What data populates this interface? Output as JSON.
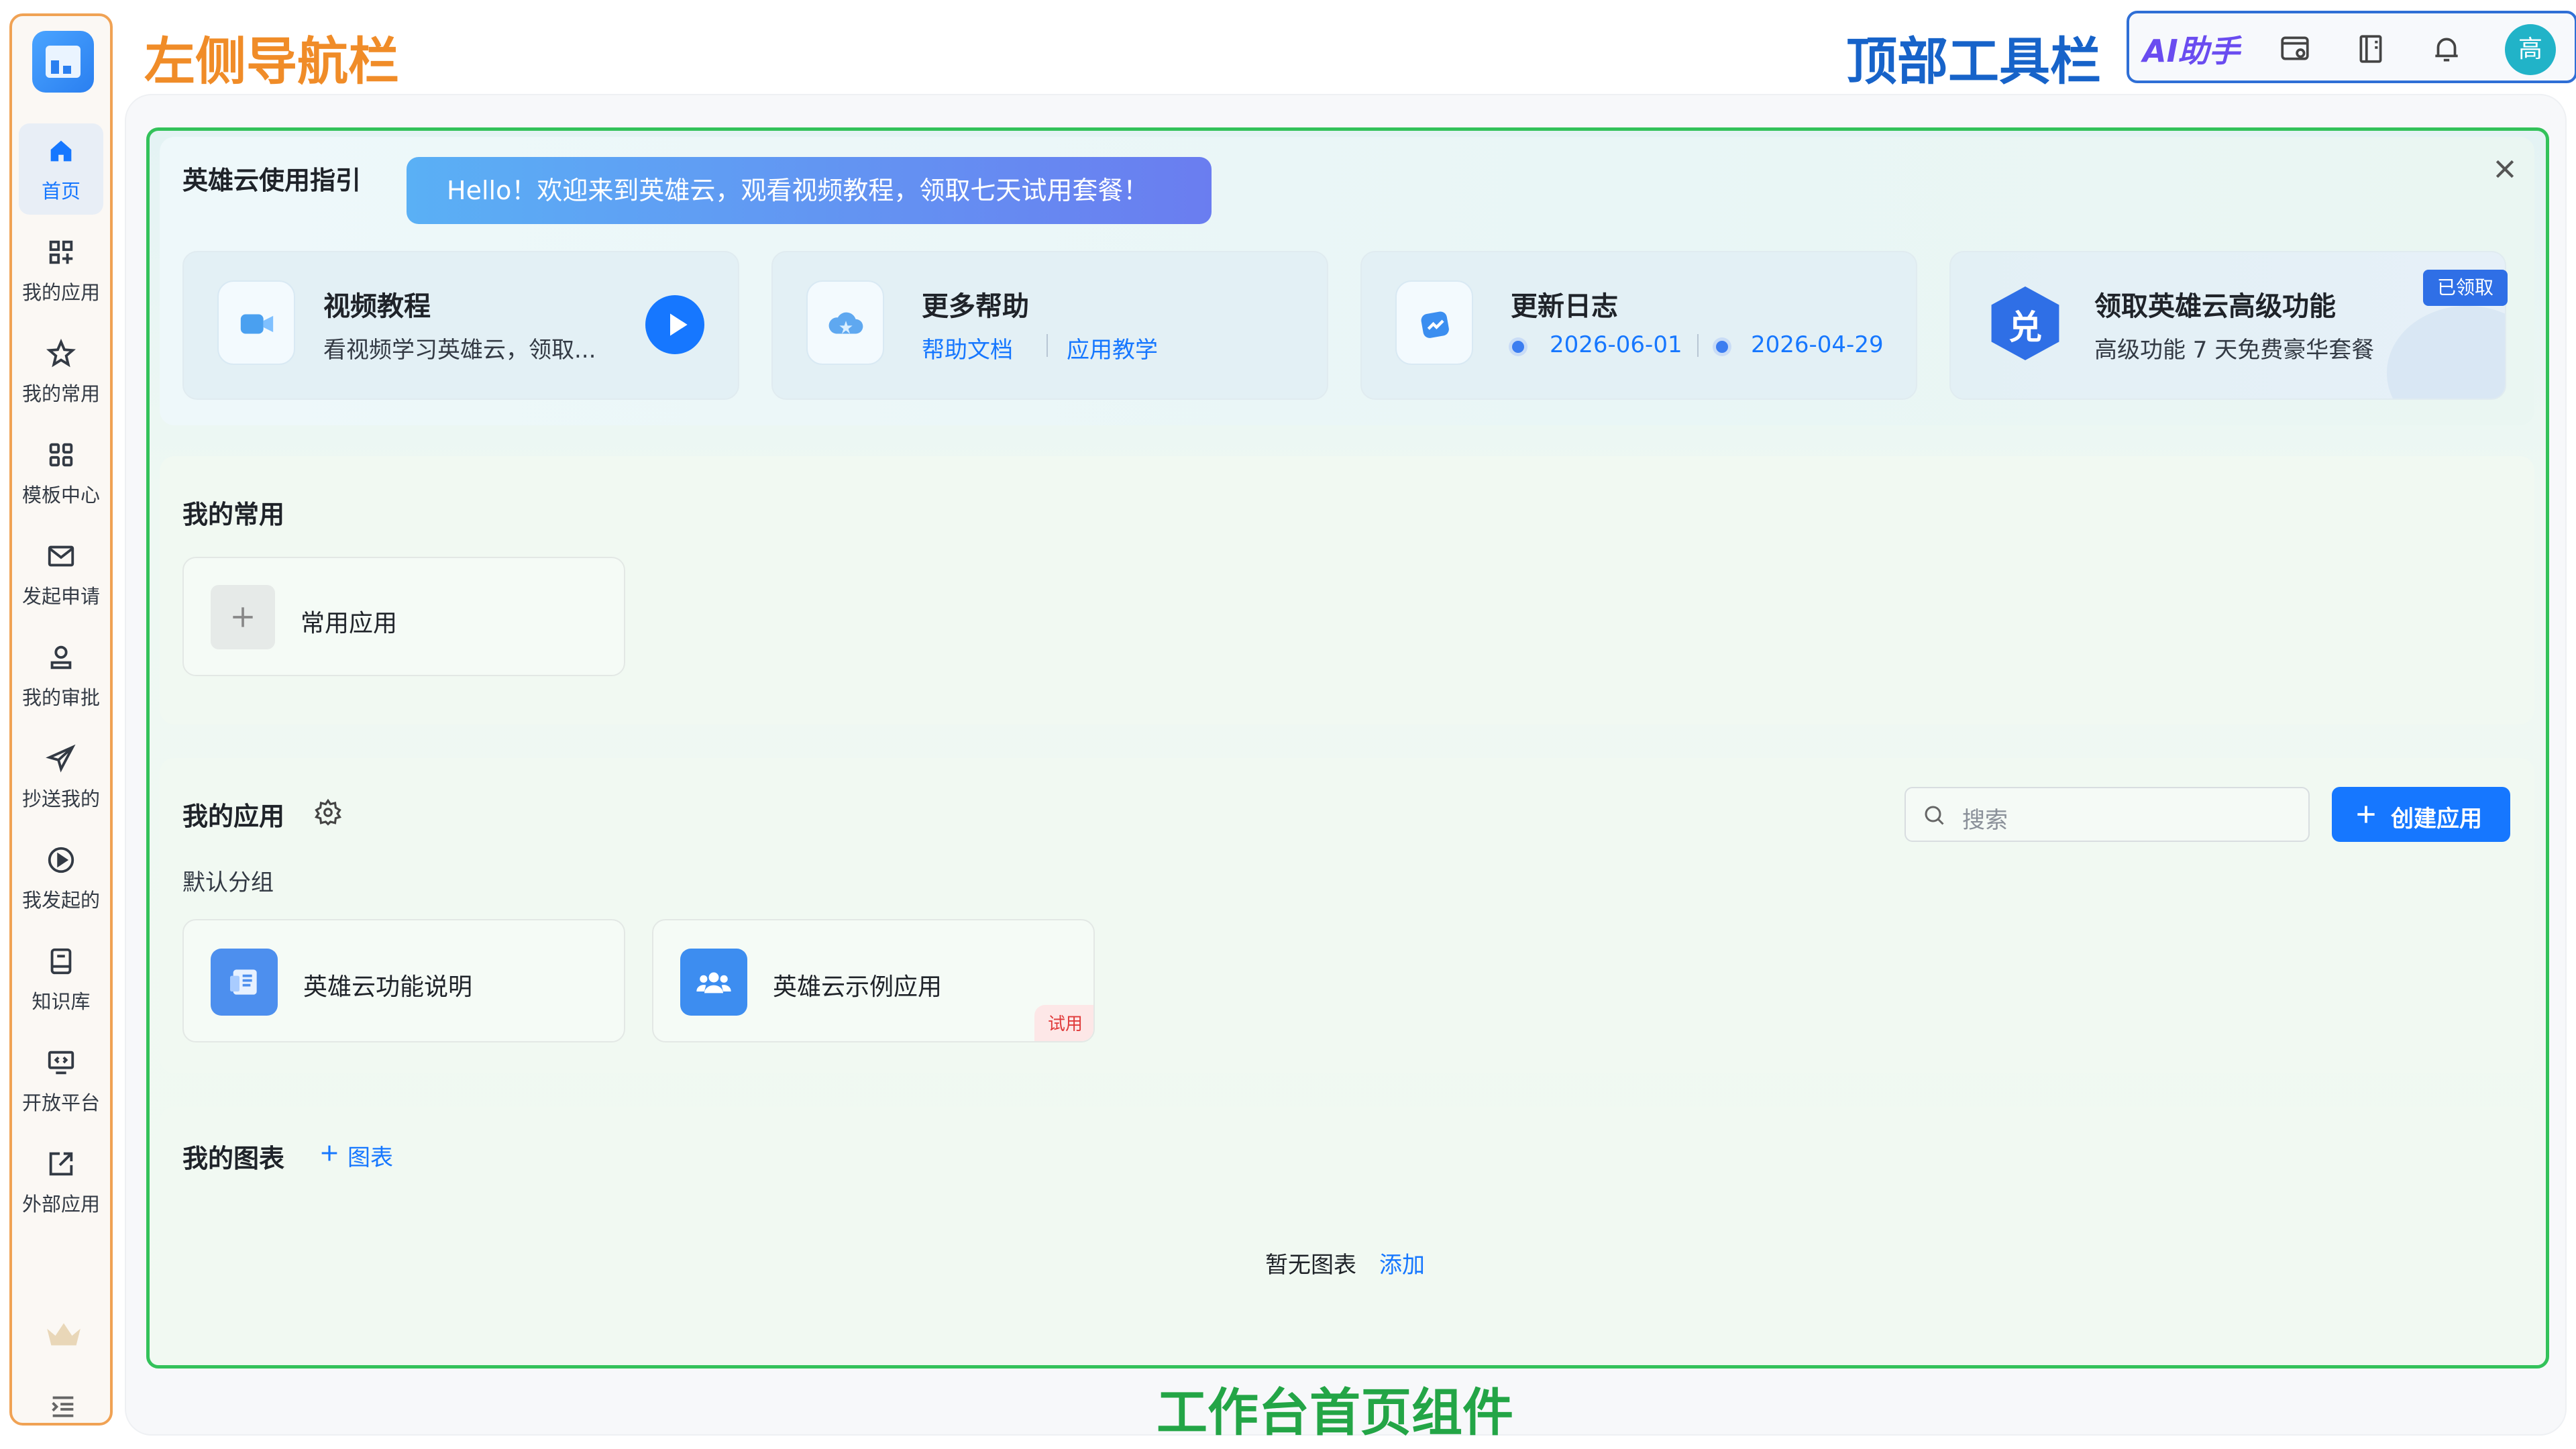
{
  "annotations": {
    "left_nav": "左侧导航栏",
    "top_toolbar": "顶部工具栏",
    "workbench": "工作台首页组件"
  },
  "colors": {
    "sidebar_border": "#f0a254",
    "toolbar_border": "#2f6fd6",
    "workbench_border": "#33c25a",
    "primary": "#1677ff",
    "annotation_orange": "#f08c28",
    "annotation_blue": "#1763c9",
    "annotation_green": "#23a546"
  },
  "sidebar": {
    "items": [
      {
        "label": "首页",
        "icon": "home-icon",
        "active": true
      },
      {
        "label": "我的应用",
        "icon": "apps-grid-icon"
      },
      {
        "label": "我的常用",
        "icon": "star-icon"
      },
      {
        "label": "模板中心",
        "icon": "template-grid-icon"
      },
      {
        "label": "发起申请",
        "icon": "mail-send-icon"
      },
      {
        "label": "我的审批",
        "icon": "user-approve-icon"
      },
      {
        "label": "抄送我的",
        "icon": "paper-plane-icon"
      },
      {
        "label": "我发起的",
        "icon": "play-circle-icon"
      },
      {
        "label": "知识库",
        "icon": "book-icon"
      },
      {
        "label": "开放平台",
        "icon": "open-platform-icon"
      },
      {
        "label": "外部应用",
        "icon": "external-link-icon"
      }
    ]
  },
  "toolbar": {
    "ai_label": "AI助手",
    "avatar_text": "高"
  },
  "guide": {
    "title": "英雄云使用指引",
    "banner": "Hello！欢迎来到英雄云，观看视频教程，领取七天试用套餐！",
    "cards": {
      "video": {
        "title": "视频教程",
        "desc": "看视频学习英雄云，领取..."
      },
      "help": {
        "title": "更多帮助",
        "link1": "帮助文档",
        "link2": "应用教学"
      },
      "changelog": {
        "title": "更新日志",
        "date1": "2026-06-01",
        "date2": "2026-04-29"
      },
      "premium": {
        "title": "领取英雄云高级功能",
        "desc": "高级功能 7 天免费豪华套餐",
        "badge": "已领取",
        "icon_text": "兑"
      }
    }
  },
  "favorites": {
    "title": "我的常用",
    "add_label": "常用应用"
  },
  "apps": {
    "title": "我的应用",
    "search_placeholder": "搜索",
    "create_label": "创建应用",
    "group_label": "默认分组",
    "items": [
      {
        "name": "英雄云功能说明"
      },
      {
        "name": "英雄云示例应用",
        "badge": "试用"
      }
    ]
  },
  "charts": {
    "title": "我的图表",
    "add_label": "图表",
    "empty_text": "暂无图表",
    "empty_action": "添加"
  }
}
